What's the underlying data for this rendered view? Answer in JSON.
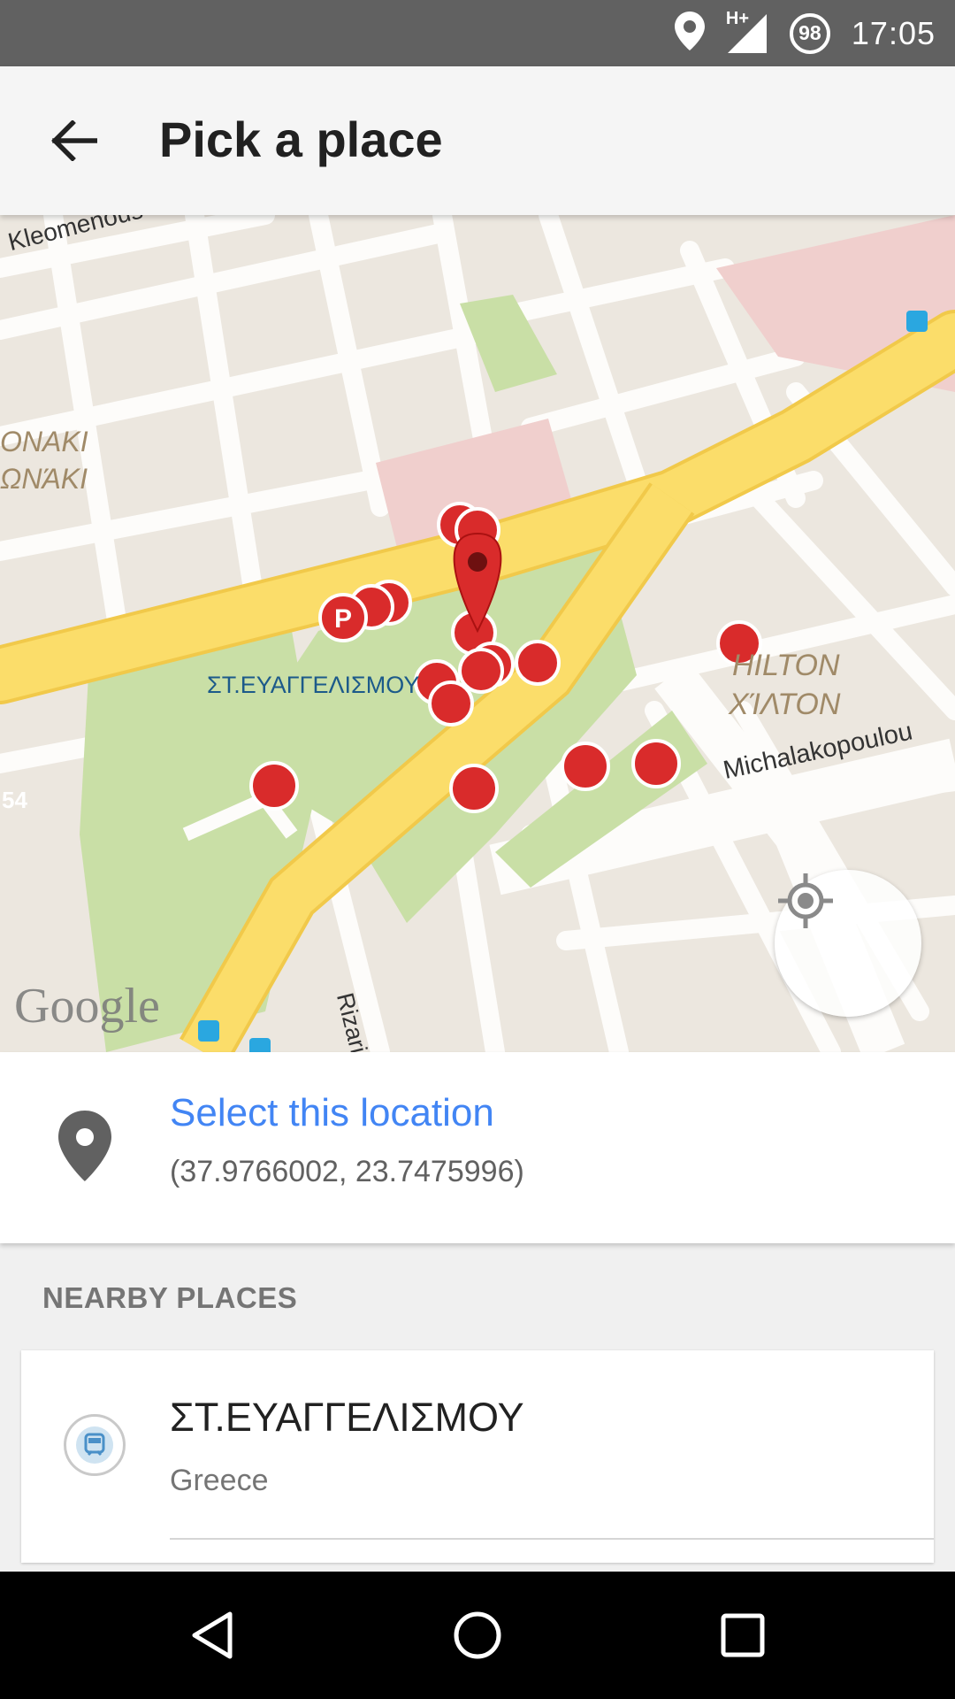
{
  "status_bar": {
    "network": "H+",
    "battery": "98",
    "time": "17:05",
    "icons": [
      "location-icon",
      "signal-icon",
      "battery-icon"
    ]
  },
  "app_bar": {
    "title": "Pick a place",
    "back_icon": "arrow-back-icon"
  },
  "map": {
    "labels": {
      "street_kleomenous": "Kleomenous",
      "area_left_1": "ΟΝΑΚΙ",
      "area_left_2": "ΩΝΆΚΙ",
      "station": "ΣΤ.ΕΥΑΓΓΕΛΙΣΜΟΥ",
      "hilton_en": "HILTON",
      "hilton_gr": "ΧΊΛΤΟΝ",
      "street_michalakopoulou": "Michalakopoulou",
      "street_rizari": "Rizari",
      "road_number": "54",
      "google": "Google"
    },
    "my_location_icon": "my-location-icon",
    "colors": {
      "road_major": "#fbdd6a",
      "park": "#c9dfa6",
      "hospital": "#f0cfcd",
      "poi": "#d92b2b"
    }
  },
  "selection": {
    "title": "Select this location",
    "coords": "(37.9766002, 23.7475996)",
    "icon": "place-pin-icon"
  },
  "nearby": {
    "header": "NEARBY PLACES",
    "items": [
      {
        "name": "ΣΤ.ΕΥΑΓΓΕΛΙΣΜΟΥ",
        "subtitle": "Greece",
        "icon": "train-icon"
      }
    ]
  },
  "nav_bar": {
    "icons": [
      "back-triangle-icon",
      "home-circle-icon",
      "recents-square-icon"
    ]
  }
}
